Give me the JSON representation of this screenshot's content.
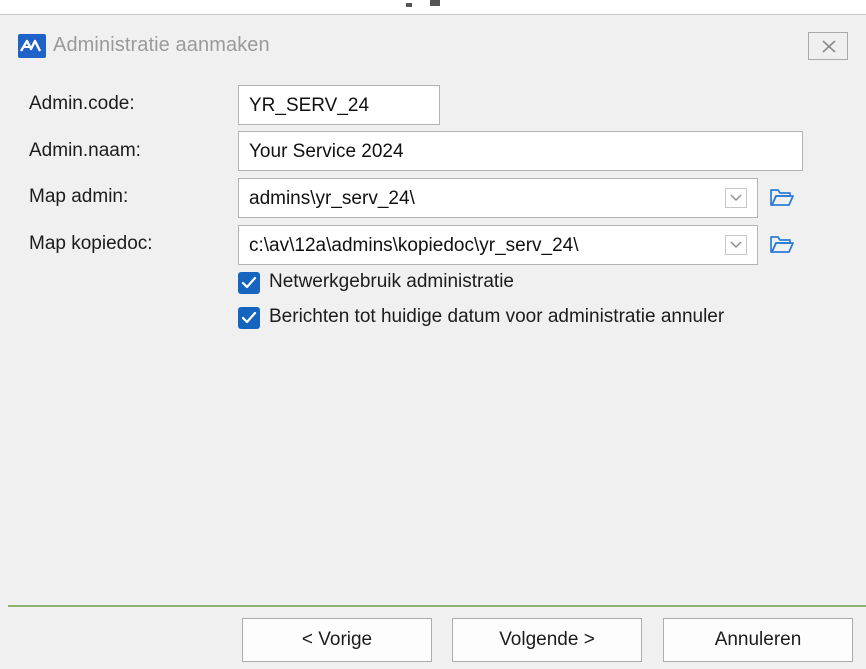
{
  "window": {
    "title": "Administratie aanmaken",
    "close_icon": "close-icon",
    "accent_color": "#1565c0"
  },
  "form": {
    "admin_code": {
      "label": "Admin.code:",
      "value": "YR_SERV_24"
    },
    "admin_naam": {
      "label": "Admin.naam:",
      "value": "Your Service 2024"
    },
    "map_admin": {
      "label": "Map admin:",
      "value": "admins\\yr_serv_24\\",
      "icon": "folder-icon"
    },
    "map_kopiedoc": {
      "label": "Map kopiedoc:",
      "value": "c:\\av\\12a\\admins\\kopiedoc\\yr_serv_24\\",
      "icon": "folder-icon"
    },
    "checkboxes": [
      {
        "label": "Netwerkgebruik administratie",
        "checked": true
      },
      {
        "label": "Berichten tot huidige datum voor administratie annuler",
        "checked": true
      }
    ]
  },
  "buttons": {
    "previous": "< Vorige",
    "next": "Volgende >",
    "cancel": "Annuleren"
  }
}
